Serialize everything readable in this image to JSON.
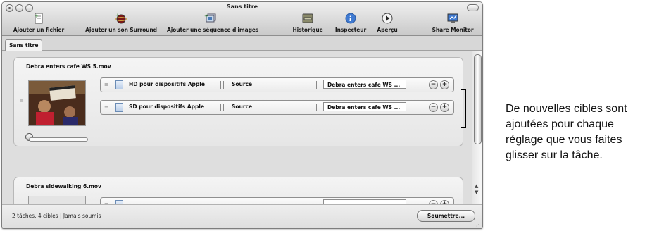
{
  "window": {
    "title": "Sans titre"
  },
  "toolbar": {
    "items": [
      {
        "label": "Ajouter un fichier",
        "icon": "add-file-icon"
      },
      {
        "label": "Ajouter un son Surround",
        "icon": "surround-sound-icon"
      },
      {
        "label": "Ajouter une séquence d'images",
        "icon": "image-sequence-icon"
      },
      {
        "label": "Historique",
        "icon": "history-drawer-icon"
      },
      {
        "label": "Inspecteur",
        "icon": "inspector-info-icon"
      },
      {
        "label": "Aperçu",
        "icon": "preview-play-icon"
      },
      {
        "label": "Share Monitor",
        "icon": "share-monitor-icon"
      }
    ]
  },
  "tabs": [
    {
      "label": "Sans titre"
    }
  ],
  "jobs": [
    {
      "name": "Debra enters cafe WS 5.mov",
      "targets": [
        {
          "setting": "HD pour dispositifs Apple",
          "destination": "Source",
          "output": "Debra enters cafe WS ..."
        },
        {
          "setting": "SD pour dispositifs Apple",
          "destination": "Source",
          "output": "Debra enters cafe WS ..."
        }
      ]
    },
    {
      "name": "Debra sidewalking 6.mov",
      "targets": []
    }
  ],
  "status": {
    "text": "2 tâches, 4 cibles  |  Jamais soumis",
    "submit_label": "Soumettre..."
  },
  "callout": {
    "text": "De nouvelles cibles sont ajoutées pour chaque réglage que vous faites glisser sur la tâche."
  },
  "colors": {
    "accent_blue": "#3f7ad1",
    "preview_target": "#6b8cb5"
  }
}
